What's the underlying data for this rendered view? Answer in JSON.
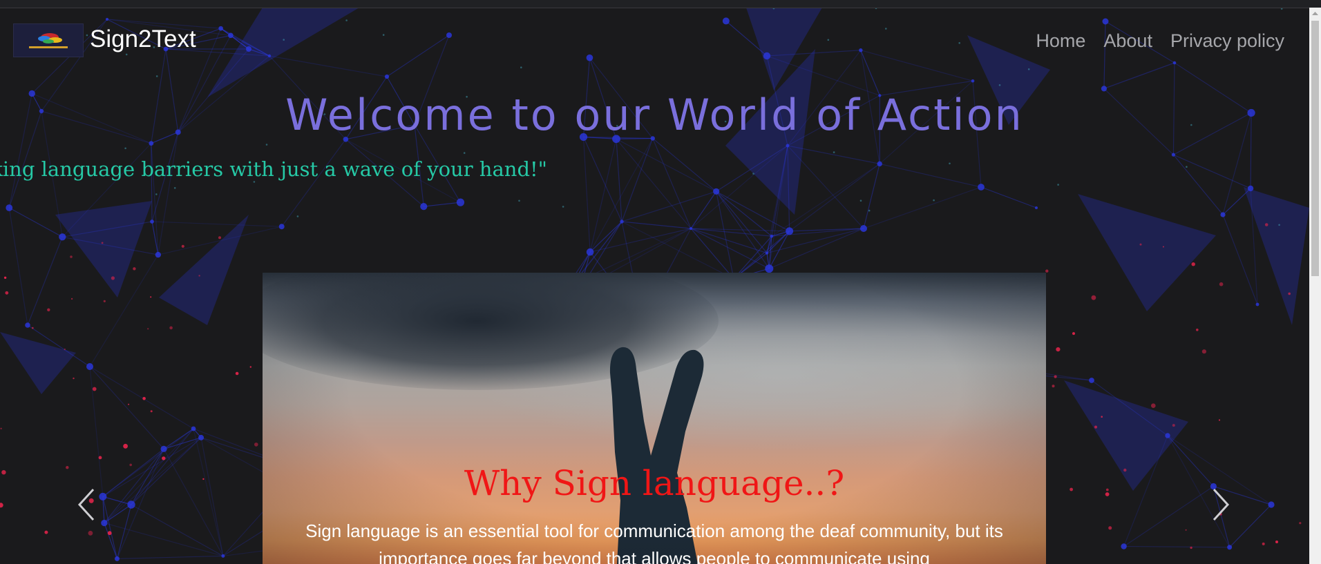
{
  "navbar": {
    "brand": "Sign2Text",
    "logo_icon": "sign2text-logo",
    "links": [
      {
        "label": "Home"
      },
      {
        "label": "About"
      },
      {
        "label": "Privacy policy"
      }
    ]
  },
  "hero": {
    "title": "Welcome to our World of Action",
    "tagline": "\"Breaking language barriers with just a wave of your hand!\""
  },
  "carousel": {
    "slide": {
      "image": "peace-sign-hand-silhouette-sunset",
      "title": "Why Sign language..?",
      "text": "Sign language is an essential tool for communication among the deaf community, but its importance goes far beyond that allows people to communicate using"
    },
    "prev_icon": "chevron-left-icon",
    "next_icon": "chevron-right-icon"
  },
  "colors": {
    "background": "#1a1a1c",
    "title": "#7a6fdc",
    "tagline": "#26c9a6",
    "caption_title": "#f01616",
    "nav_link": "#a6a7ab",
    "network_lines": "#2a36d8",
    "particles": "#e0244a"
  }
}
